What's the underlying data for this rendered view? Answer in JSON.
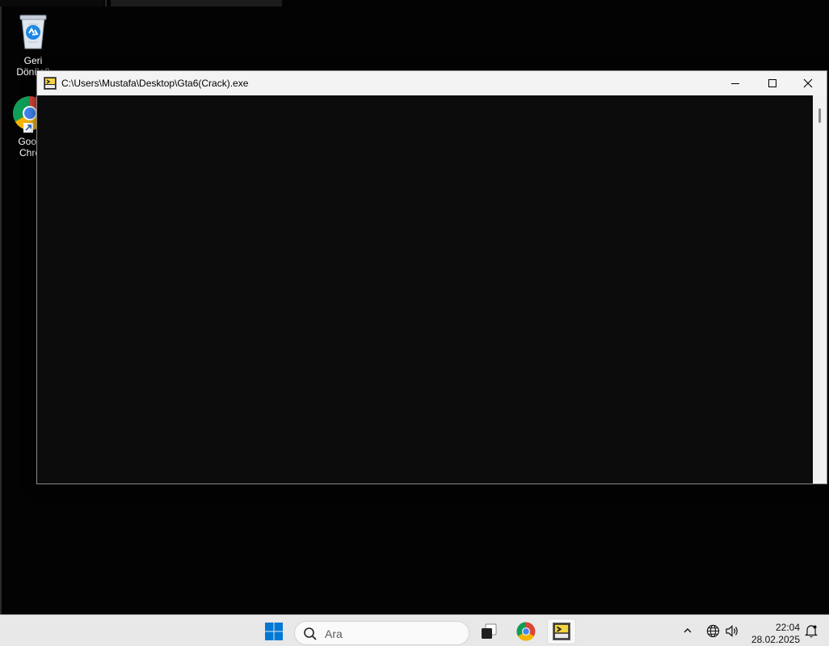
{
  "desktop": {
    "icons": [
      {
        "label_line1": "Geri",
        "label_line2": "Dönüşü",
        "icon": "recycle-bin-icon"
      },
      {
        "label_line1": "Goog",
        "label_line2": "Chro",
        "icon": "chrome-icon"
      }
    ]
  },
  "window": {
    "title": "C:\\Users\\Mustafa\\Desktop\\Gta6(Crack).exe",
    "icon": "console-app-icon",
    "minimize_icon": "minimize-icon",
    "maximize_icon": "maximize-icon",
    "close_icon": "close-icon",
    "console_background": "#0c0c0c"
  },
  "taskbar": {
    "search_placeholder": "Ara",
    "apps": [
      "start-icon",
      "task-view-icon",
      "chrome-icon",
      "console-app-icon"
    ],
    "tray": [
      "chevron-up-icon",
      "network-globe-icon",
      "volume-icon",
      "notification-icon"
    ],
    "time": "22:04",
    "date": "28.02.2025"
  },
  "colors": {
    "desktop": "#030303",
    "taskbar": "#e8e8e8",
    "start_blue": "#0078d4"
  }
}
